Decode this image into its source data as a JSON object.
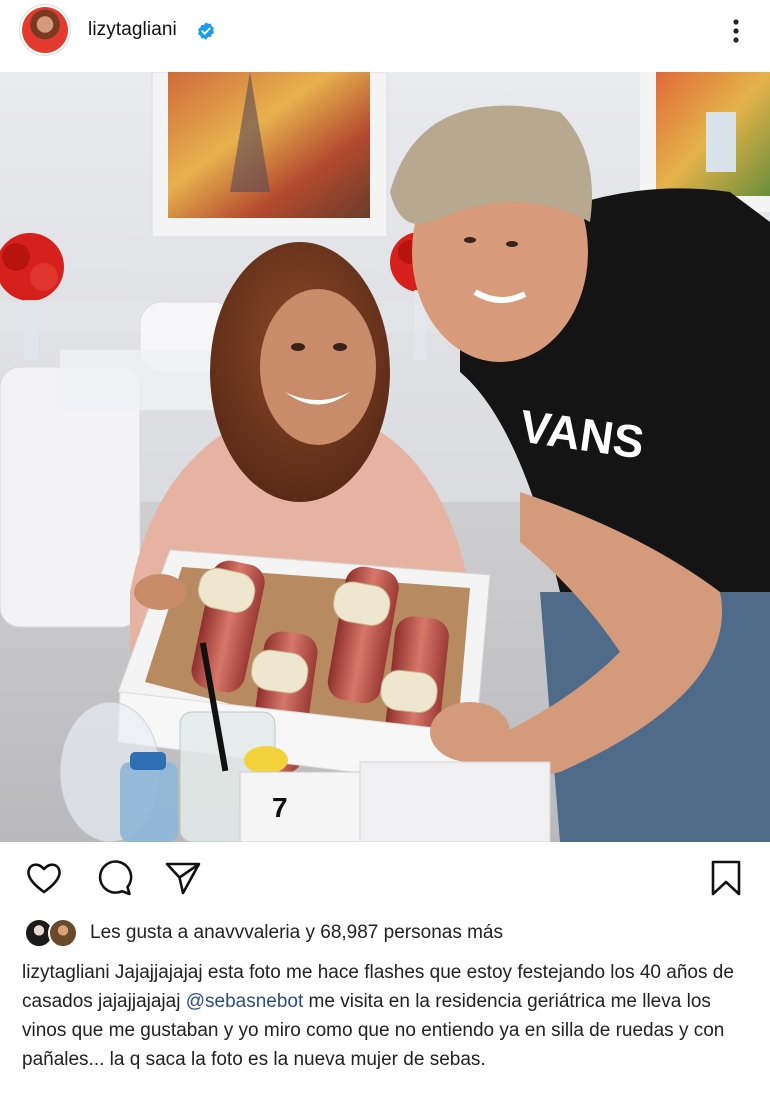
{
  "header": {
    "username": "lizytagliani",
    "avatar_icon": "profile-avatar",
    "verified_icon": "verified-badge-icon",
    "menu_icon": "more-options-icon"
  },
  "post": {
    "image_description_alt": "lizytagliani post photo"
  },
  "actions": {
    "like_icon": "heart-icon",
    "comment_icon": "comment-icon",
    "share_icon": "send-icon",
    "save_icon": "bookmark-icon"
  },
  "likes": {
    "prefix": "Les gusta a ",
    "user": "anavvvaleria",
    "middle": " y ",
    "count": "68,987",
    "suffix": " personas más"
  },
  "caption": {
    "username": "lizytagliani",
    "part1": " Jajajjajajaj esta foto me hace flashes que estoy  festejando los 40 años de casados jajajjajajaj ",
    "mention": "@sebasnebot",
    "part2": " me visita en la residencia geriátrica me lleva los vinos que me gustaban y yo miro como que no entiendo ya en silla de ruedas y con pañales... la q saca la foto es la nueva mujer de sebas."
  },
  "colors": {
    "verified": "#1d9bf0",
    "mention": "#2b4c8c",
    "shirt_text": "VANS"
  }
}
